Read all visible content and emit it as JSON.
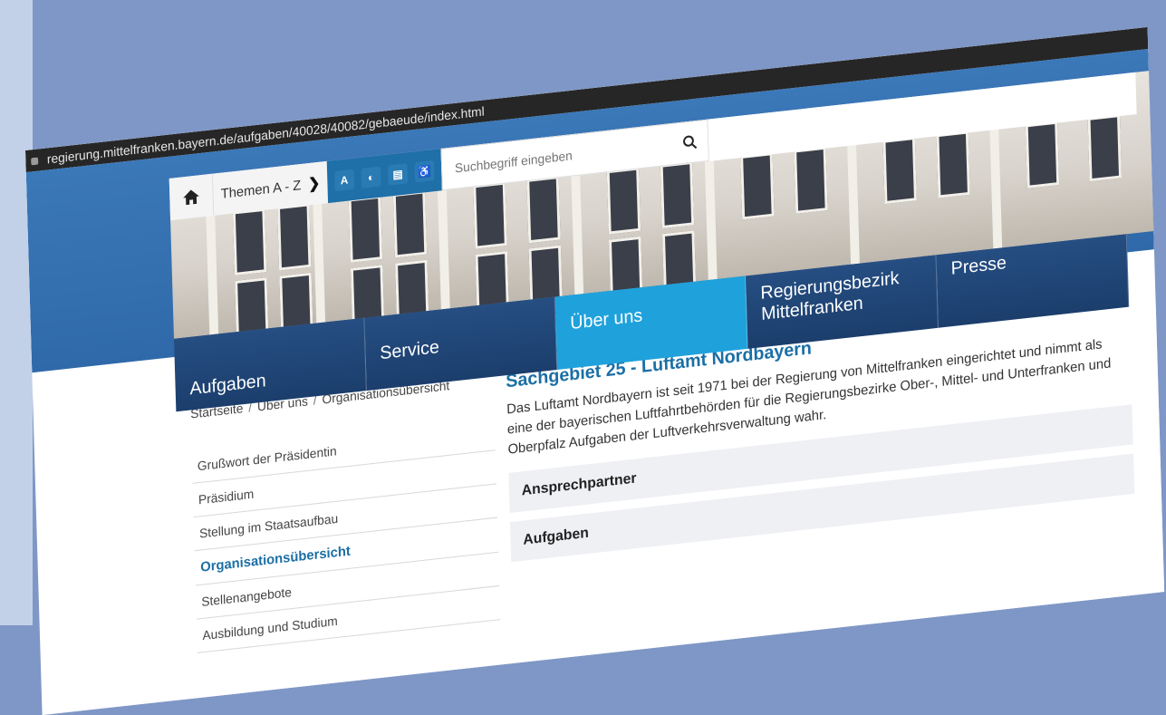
{
  "browser": {
    "url": "regierung.mittelfranken.bayern.de/aufgaben/40028/40082/gebaeude/index.html"
  },
  "topnav": {
    "themen_label": "Themen A - Z",
    "tools": [
      "A",
      "◐",
      "▤",
      "♿"
    ],
    "search_placeholder": "Suchbegriff eingeben"
  },
  "mainnav": [
    {
      "label": "Aufgaben"
    },
    {
      "label": "Service"
    },
    {
      "label": "Über uns"
    },
    {
      "label": "Regierungsbezirk",
      "label2": "Mittelfranken"
    },
    {
      "label": "Presse"
    }
  ],
  "breadcrumb": [
    "Startseite",
    "Über uns",
    "Organisationsübersicht"
  ],
  "sidenav": [
    "Grußwort der Präsidentin",
    "Präsidium",
    "Stellung im Staatsaufbau",
    "Organisationsübersicht",
    "Stellenangebote",
    "Ausbildung und Studium"
  ],
  "main": {
    "title": "Sachgebiet 25 - Luftamt Nordbayern",
    "intro": "Das Luftamt Nordbayern ist seit 1971 bei der Regierung von Mittelfranken eingerichtet und nimmt als eine der bayerischen Luftfahrtbehörden für die Regierungsbezirke Ober-, Mittel- und Unterfranken und Oberpfalz Aufgaben der Luftverkehrsverwaltung wahr.",
    "accordions": [
      "Ansprechpartner",
      "Aufgaben"
    ]
  }
}
